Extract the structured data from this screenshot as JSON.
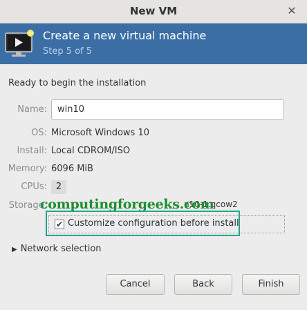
{
  "window": {
    "title": "New VM",
    "close_glyph": "✕"
  },
  "banner": {
    "heading": "Create a new virtual machine",
    "step": "Step 5 of 5",
    "icon": "vm-monitor-icon"
  },
  "summary": {
    "ready_text": "Ready to begin the installation",
    "name_label": "Name:",
    "name_value": "win10",
    "os_label": "OS:",
    "os_value": "Microsoft Windows 10",
    "install_label": "Install:",
    "install_value": "Local CDROM/ISO",
    "memory_label": "Memory:",
    "memory_value": "6096 MiB",
    "cpus_label": "CPUs:",
    "cpus_value": "2",
    "storage_label": "Storage:",
    "storage_value": "n10-1.qcow2"
  },
  "watermark": "computingforgeeks.com",
  "customize": {
    "label": "Customize configuration before install",
    "checked": "✔"
  },
  "network": {
    "label": "Network selection",
    "arrow": "▶"
  },
  "buttons": {
    "cancel": "Cancel",
    "back": "Back",
    "finish": "Finish"
  },
  "colors": {
    "banner": "#3b6ea5",
    "highlight": "#22a68f",
    "watermark": "#1f8f2e"
  }
}
